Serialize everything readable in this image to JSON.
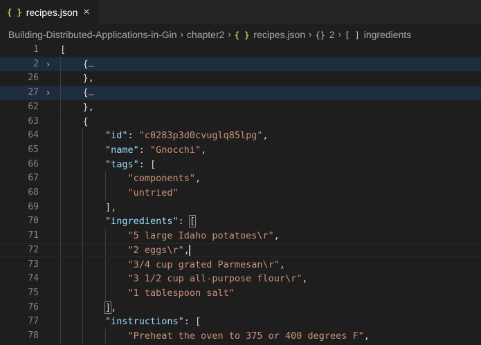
{
  "tab": {
    "label": "recipes.json",
    "icon": "json-icon",
    "close": "×"
  },
  "breadcrumb": {
    "items": [
      "Building-Distributed-Applications-in-Gin",
      "chapter2",
      "recipes.json",
      "2",
      "ingredients"
    ],
    "icons": {
      "2": "{}",
      "4": "[ ]"
    },
    "sep": "›"
  },
  "editor": {
    "lines": [
      {
        "num": "1",
        "indent": 0,
        "fold": "",
        "tokens": [
          {
            "t": "p",
            "v": "["
          }
        ]
      },
      {
        "num": "2",
        "indent": 1,
        "fold": "›",
        "hl": true,
        "tokens": [
          {
            "t": "p",
            "v": "{"
          },
          {
            "t": "c",
            "v": "…"
          }
        ]
      },
      {
        "num": "26",
        "indent": 1,
        "fold": "",
        "tokens": [
          {
            "t": "p",
            "v": "},"
          }
        ]
      },
      {
        "num": "27",
        "indent": 1,
        "fold": "›",
        "hl": true,
        "tokens": [
          {
            "t": "p",
            "v": "{"
          },
          {
            "t": "c",
            "v": "…"
          }
        ]
      },
      {
        "num": "62",
        "indent": 1,
        "fold": "",
        "tokens": [
          {
            "t": "p",
            "v": "},"
          }
        ]
      },
      {
        "num": "63",
        "indent": 1,
        "fold": "",
        "tokens": [
          {
            "t": "p",
            "v": "{"
          }
        ]
      },
      {
        "num": "64",
        "indent": 2,
        "fold": "",
        "tokens": [
          {
            "t": "k",
            "v": "\"id\""
          },
          {
            "t": "p",
            "v": ": "
          },
          {
            "t": "s",
            "v": "\"c0283p3d0cvuglq85lpg\""
          },
          {
            "t": "p",
            "v": ","
          }
        ]
      },
      {
        "num": "65",
        "indent": 2,
        "fold": "",
        "tokens": [
          {
            "t": "k",
            "v": "\"name\""
          },
          {
            "t": "p",
            "v": ": "
          },
          {
            "t": "s",
            "v": "\"Gnocchi\""
          },
          {
            "t": "p",
            "v": ","
          }
        ]
      },
      {
        "num": "66",
        "indent": 2,
        "fold": "",
        "tokens": [
          {
            "t": "k",
            "v": "\"tags\""
          },
          {
            "t": "p",
            "v": ": ["
          }
        ]
      },
      {
        "num": "67",
        "indent": 3,
        "fold": "",
        "tokens": [
          {
            "t": "s",
            "v": "\"components\""
          },
          {
            "t": "p",
            "v": ","
          }
        ]
      },
      {
        "num": "68",
        "indent": 3,
        "fold": "",
        "tokens": [
          {
            "t": "s",
            "v": "\"untried\""
          }
        ]
      },
      {
        "num": "69",
        "indent": 2,
        "fold": "",
        "tokens": [
          {
            "t": "p",
            "v": "],"
          }
        ]
      },
      {
        "num": "70",
        "indent": 2,
        "fold": "",
        "tokens": [
          {
            "t": "k",
            "v": "\"ingredients\""
          },
          {
            "t": "p",
            "v": ": "
          },
          {
            "t": "bm",
            "v": "["
          }
        ]
      },
      {
        "num": "71",
        "indent": 3,
        "fold": "",
        "tokens": [
          {
            "t": "s",
            "v": "\"5 large Idaho potatoes\\r\""
          },
          {
            "t": "p",
            "v": ","
          }
        ]
      },
      {
        "num": "72",
        "indent": 3,
        "fold": "",
        "cur": true,
        "tokens": [
          {
            "t": "s",
            "v": "\"2 eggs\\r\""
          },
          {
            "t": "p",
            "v": ","
          },
          {
            "t": "caret",
            "v": ""
          }
        ]
      },
      {
        "num": "73",
        "indent": 3,
        "fold": "",
        "tokens": [
          {
            "t": "s",
            "v": "\"3/4 cup grated Parmesan\\r\""
          },
          {
            "t": "p",
            "v": ","
          }
        ]
      },
      {
        "num": "74",
        "indent": 3,
        "fold": "",
        "tokens": [
          {
            "t": "s",
            "v": "\"3 1/2 cup all-purpose flour\\r\""
          },
          {
            "t": "p",
            "v": ","
          }
        ]
      },
      {
        "num": "75",
        "indent": 3,
        "fold": "",
        "tokens": [
          {
            "t": "s",
            "v": "\"1 tablespoon salt\""
          }
        ]
      },
      {
        "num": "76",
        "indent": 2,
        "fold": "",
        "tokens": [
          {
            "t": "bm",
            "v": "]"
          },
          {
            "t": "p",
            "v": ","
          }
        ]
      },
      {
        "num": "77",
        "indent": 2,
        "fold": "",
        "tokens": [
          {
            "t": "k",
            "v": "\"instructions\""
          },
          {
            "t": "p",
            "v": ": ["
          }
        ]
      },
      {
        "num": "78",
        "indent": 3,
        "fold": "",
        "tokens": [
          {
            "t": "s",
            "v": "\"Preheat the oven to 375 or 400 degrees F\""
          },
          {
            "t": "p",
            "v": ","
          }
        ]
      }
    ]
  }
}
